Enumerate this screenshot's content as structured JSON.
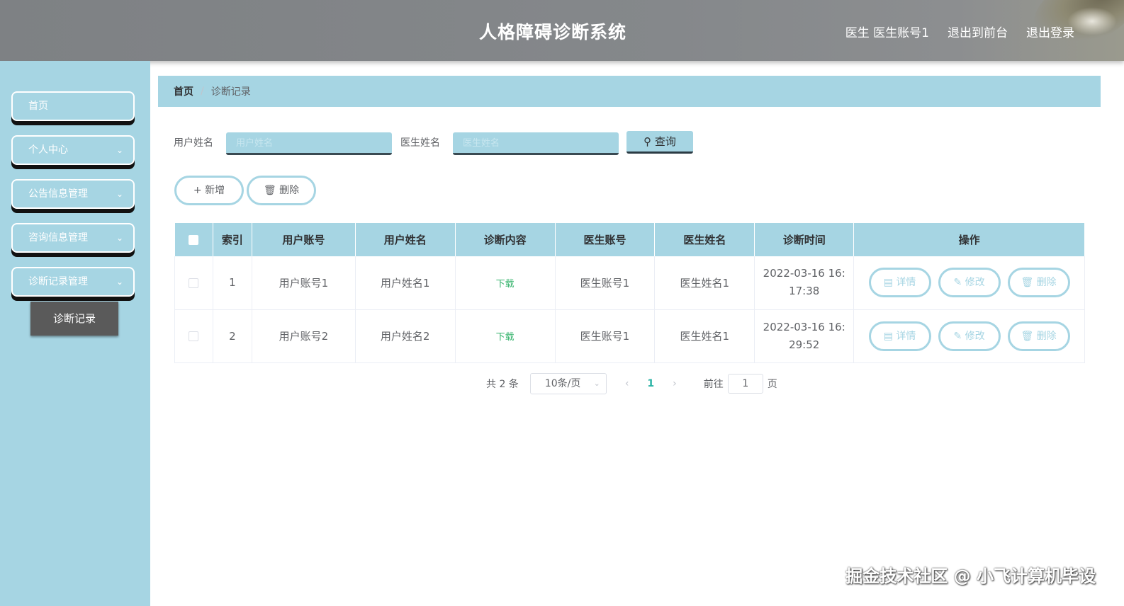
{
  "header": {
    "title": "人格障碍诊断系统",
    "user_role": "医生",
    "user_name": "医生账号1",
    "back_front": "退出到前台",
    "logout": "退出登录"
  },
  "sidebar": {
    "items": [
      {
        "label": "首页"
      },
      {
        "label": "个人中心"
      },
      {
        "label": "公告信息管理"
      },
      {
        "label": "咨询信息管理"
      },
      {
        "label": "诊断记录管理"
      }
    ],
    "sub_item": "诊断记录"
  },
  "breadcrumb": {
    "home": "首页",
    "separator": "/",
    "current": "诊断记录"
  },
  "search": {
    "user_label": "用户姓名",
    "user_placeholder": "用户姓名",
    "doctor_label": "医生姓名",
    "doctor_placeholder": "医生姓名",
    "query": "查询"
  },
  "actions": {
    "add": "新增",
    "delete": "删除"
  },
  "table": {
    "headers": [
      "索引",
      "用户账号",
      "用户姓名",
      "诊断内容",
      "医生账号",
      "医生姓名",
      "诊断时间",
      "操作"
    ],
    "rows": [
      {
        "index": "1",
        "user_account": "用户账号1",
        "user_name": "用户姓名1",
        "content": "下载",
        "doctor_account": "医生账号1",
        "doctor_name": "医生姓名1",
        "time_line1": "2022-03-16 16:",
        "time_line2": "17:38"
      },
      {
        "index": "2",
        "user_account": "用户账号2",
        "user_name": "用户姓名2",
        "content": "下载",
        "doctor_account": "医生账号1",
        "doctor_name": "医生姓名1",
        "time_line1": "2022-03-16 16:",
        "time_line2": "29:52"
      }
    ],
    "ops": {
      "detail": "详情",
      "edit": "修改",
      "delete": "删除"
    }
  },
  "pagination": {
    "total": "共 2 条",
    "page_size": "10条/页",
    "current": "1",
    "goto_label": "前往",
    "goto_value": "1",
    "page_suffix": "页"
  },
  "watermark": "掘金技术社区 @ 小飞计算机毕设",
  "colors": {
    "accent": "#a6d5e3",
    "header": "#85888b",
    "link_green": "#35b36c"
  }
}
